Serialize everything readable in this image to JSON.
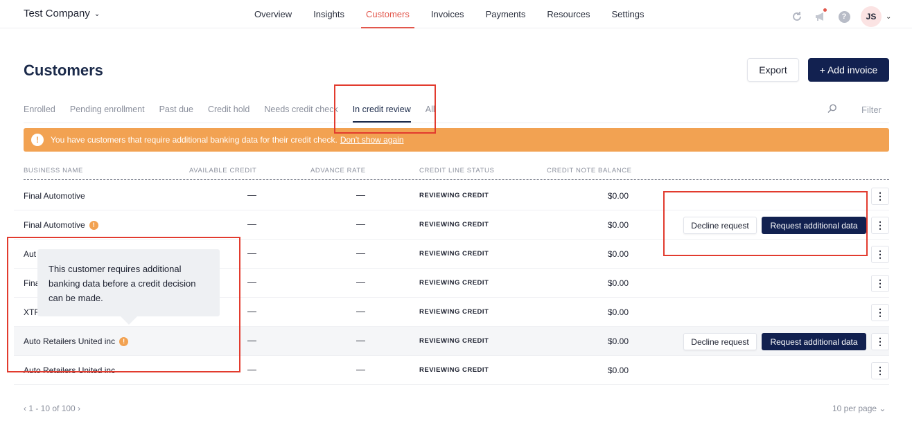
{
  "company": {
    "name": "Test Company"
  },
  "nav": {
    "items": [
      {
        "label": "Overview"
      },
      {
        "label": "Insights"
      },
      {
        "label": "Customers",
        "active": true
      },
      {
        "label": "Invoices"
      },
      {
        "label": "Payments"
      },
      {
        "label": "Resources"
      },
      {
        "label": "Settings"
      }
    ]
  },
  "header": {
    "avatar_initials": "JS",
    "help_glyph": "?"
  },
  "page": {
    "title": "Customers",
    "export_label": "Export",
    "add_invoice_label": "+ Add invoice"
  },
  "tabs": [
    {
      "label": "Enrolled"
    },
    {
      "label": "Pending enrollment"
    },
    {
      "label": "Past due"
    },
    {
      "label": "Credit hold"
    },
    {
      "label": "Needs credit check"
    },
    {
      "label": "In credit review",
      "active": true
    },
    {
      "label": "All"
    }
  ],
  "filter_label": "Filter",
  "banner": {
    "text": "You have customers that require additional banking data for their credit check.",
    "link": "Don't show again",
    "color": "#f2a252"
  },
  "table": {
    "headers": {
      "business_name": "BUSINESS NAME",
      "available_credit": "AVAILABLE CREDIT",
      "advance_rate": "ADVANCE RATE",
      "credit_line_status": "CREDIT LINE STATUS",
      "credit_note_balance": "CREDIT NOTE BALANCE"
    },
    "rows": [
      {
        "name": "Final Automotive",
        "warn": false,
        "available_credit": "—",
        "advance_rate": "—",
        "status": "REVIEWING CREDIT",
        "balance": "$0.00",
        "actions": false
      },
      {
        "name": "Final Automotive",
        "warn": true,
        "available_credit": "—",
        "advance_rate": "—",
        "status": "REVIEWING CREDIT",
        "balance": "$0.00",
        "actions": true
      },
      {
        "name": "Aut",
        "warn": false,
        "available_credit": "—",
        "advance_rate": "—",
        "status": "REVIEWING CREDIT",
        "balance": "$0.00",
        "actions": false
      },
      {
        "name": "Fina",
        "warn": false,
        "available_credit": "—",
        "advance_rate": "—",
        "status": "REVIEWING CREDIT",
        "balance": "$0.00",
        "actions": false
      },
      {
        "name": "XTF",
        "warn": false,
        "available_credit": "—",
        "advance_rate": "—",
        "status": "REVIEWING CREDIT",
        "balance": "$0.00",
        "actions": false
      },
      {
        "name": "Auto Retailers United inc",
        "warn": true,
        "available_credit": "—",
        "advance_rate": "—",
        "status": "REVIEWING CREDIT",
        "balance": "$0.00",
        "actions": true,
        "highlight": true
      },
      {
        "name": "Auto Retailers United inc",
        "warn": false,
        "available_credit": "—",
        "advance_rate": "—",
        "status": "REVIEWING CREDIT",
        "balance": "$0.00",
        "actions": false
      }
    ],
    "decline_label": "Decline request",
    "request_label": "Request additional data",
    "kebab_glyph": "⋮"
  },
  "tooltip": {
    "text": "This customer requires additional banking data before a credit decision can be made."
  },
  "footer": {
    "pagination": "‹ 1 - 10 of 100 ›",
    "per_page": "10 per page ⌄"
  }
}
